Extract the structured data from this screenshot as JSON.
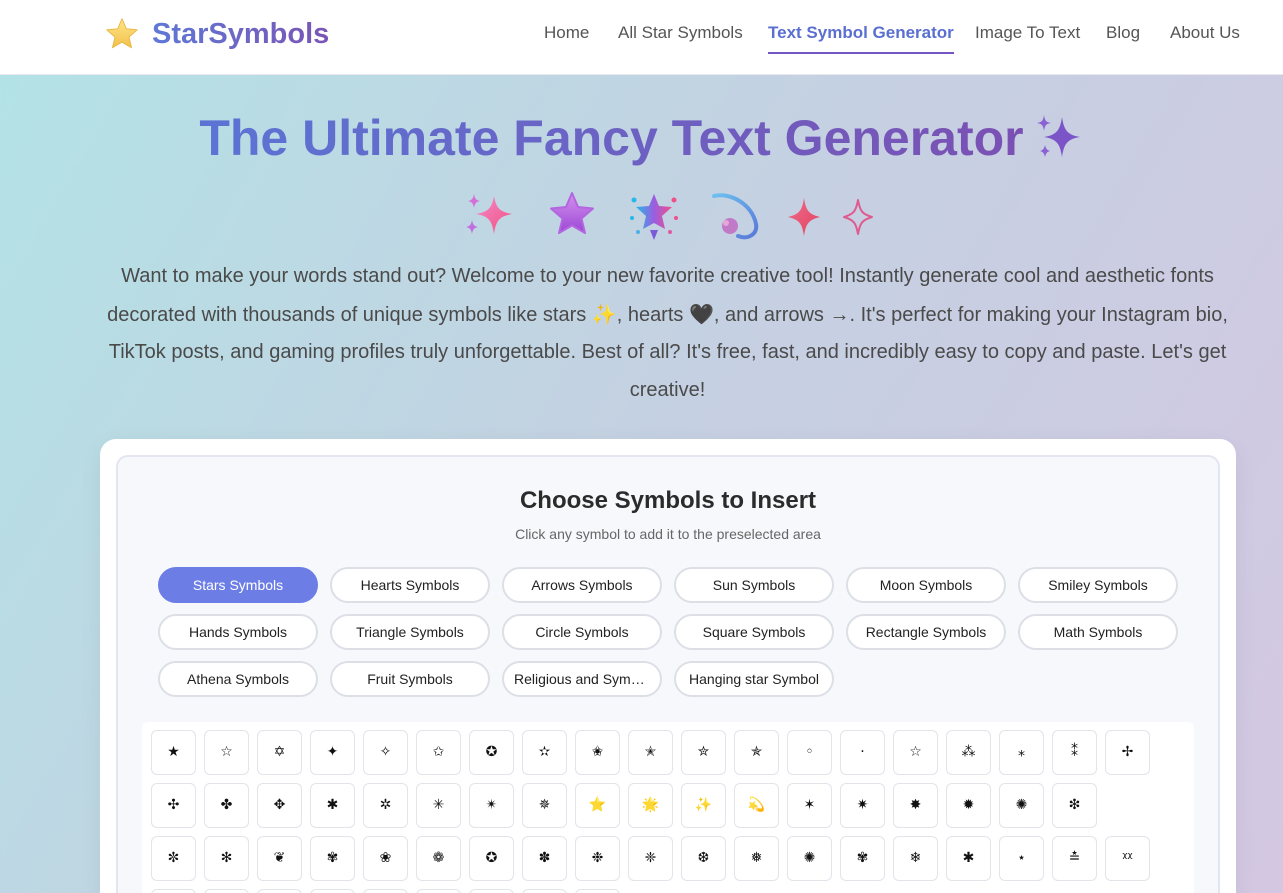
{
  "nav": {
    "brand": "StarSymbols",
    "links": [
      {
        "label": "Home"
      },
      {
        "label": "All Star Symbols"
      },
      {
        "label": "Text Symbol Generator"
      },
      {
        "label": "Image To Text"
      },
      {
        "label": "Blog"
      },
      {
        "label": "About Us"
      }
    ],
    "active_index": 2
  },
  "hero": {
    "title": "The Ultimate Fancy Text Generator",
    "title_icon": "sparkles-icon",
    "decor_icons": [
      "sparkles-pink-icon",
      "purple-star-icon",
      "sparkle-burst-icon",
      "comet-icon",
      "four-point-star-icon",
      "outline-star-icon"
    ],
    "intro_parts": {
      "p1": "Want to make your words stand out? Welcome to your new favorite creative tool! Instantly generate cool and aesthetic fonts decorated with thousands of unique symbols like stars ",
      "sparkle": "✨",
      "p2": ", hearts ",
      "heart": "🖤",
      "p3": ", and arrows →. It's perfect for making your Instagram bio, TikTok posts, and gaming profiles truly unforgettable. Best of all? It's free, fast, and incredibly easy to copy and paste. Let's get creative!"
    }
  },
  "picker": {
    "title": "Choose Symbols to Insert",
    "subtitle": "Click any symbol to add it to the preselected area",
    "categories": [
      "Stars Symbols",
      "Hearts Symbols",
      "Arrows Symbols",
      "Sun Symbols",
      "Moon Symbols",
      "Smiley Symbols",
      "Hands Symbols",
      "Triangle Symbols",
      "Circle Symbols",
      "Square Symbols",
      "Rectangle Symbols",
      "Math Symbols",
      "Athena Symbols",
      "Fruit Symbols",
      "Religious and Symb...",
      "Hanging star Symbol"
    ],
    "active_category": 0,
    "symbol_rows": [
      [
        "★",
        "☆",
        "✡",
        "✦",
        "✧",
        "✩",
        "✪",
        "✫",
        "✬",
        "✭",
        "✮",
        "✯",
        "◦",
        "·",
        "☆",
        "⁂",
        "⁎",
        "⁑",
        "✢"
      ],
      [
        "✣",
        "✤",
        "✥",
        "✱",
        "✲",
        "✳",
        "✴",
        "✵",
        "⭐",
        "🌟",
        "✨",
        "💫",
        "✶",
        "✷",
        "✸",
        "✹",
        "✺",
        "❇"
      ],
      [
        "✼",
        "✻",
        "❦",
        "✾",
        "❀",
        "❁",
        "✪",
        "✽",
        "❉",
        "❈",
        "❆",
        "❅",
        "✺",
        "✾",
        "❄",
        "✱",
        "⋆",
        "≛",
        "ᵡᵡ"
      ],
      [
        "",
        "",
        "",
        "",
        "",
        "",
        "",
        "",
        ""
      ]
    ],
    "accent_color": "#6c7ee6"
  }
}
